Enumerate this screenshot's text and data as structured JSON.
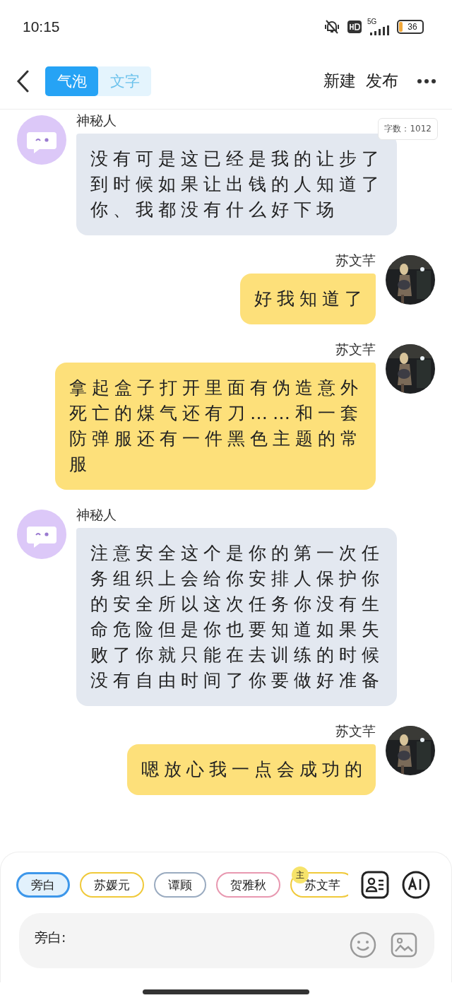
{
  "status_bar": {
    "time": "10:15",
    "network": "5G",
    "battery": "36"
  },
  "header": {
    "tabs": [
      {
        "label": "气泡",
        "selected": true
      },
      {
        "label": "文字",
        "selected": false
      }
    ],
    "actions": [
      "新建",
      "发布"
    ]
  },
  "word_count": "字数：1012",
  "messages": [
    {
      "kind": "incoming",
      "sender": "神秘人",
      "text": "没有可是这已经是我的让步了到时候如果让出钱的人知道了你、我都没有什么好下场"
    },
    {
      "kind": "outgoing",
      "sender": "苏文芊",
      "text": "好我知道了"
    },
    {
      "kind": "outgoing",
      "sender": "苏文芊",
      "text": "拿起盒子打开里面有伪造意外死亡的煤气还有刀……和一套防弹服还有一件黑色主题的常服"
    },
    {
      "kind": "incoming",
      "sender": "神秘人",
      "text": "注意安全这个是你的第一次任务组织上会给你安排人保护你的安全所以这次任务你没有生命危险但是你也要知道如果失败了你就只能在去训练的时候没有自由时间了你要做好准备"
    },
    {
      "kind": "outgoing",
      "sender": "苏文芊",
      "text": "嗯放心我一点会成功的"
    }
  ],
  "roles": [
    {
      "label": "旁白",
      "selected": true,
      "color": "#3d97ea"
    },
    {
      "label": "苏媛元",
      "selected": false,
      "color": "#f0c93a"
    },
    {
      "label": "谭顾",
      "selected": false,
      "color": "#9aabc0"
    },
    {
      "label": "贺雅秋",
      "selected": false,
      "color": "#e898b0"
    },
    {
      "label": "苏文芊",
      "selected": false,
      "color": "#f0c93a",
      "badge": "主"
    }
  ],
  "composer": {
    "placeholder": "旁白:"
  }
}
